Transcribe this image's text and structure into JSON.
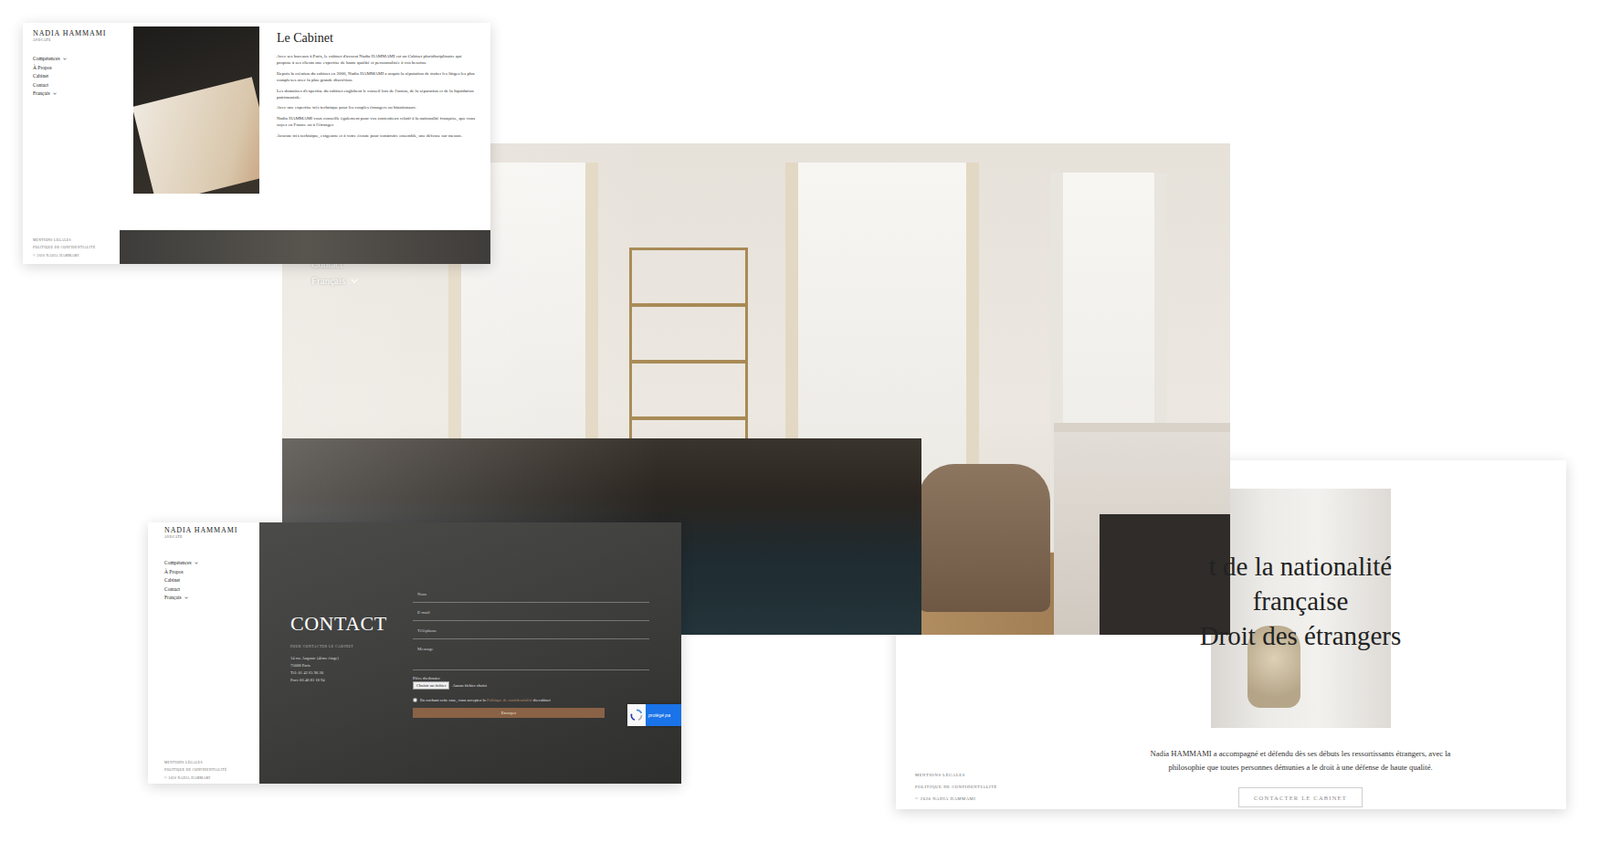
{
  "cabinet_page": {
    "logo": "NADIA HAMMAMI",
    "logo_sub": "AVOCATE",
    "nav": [
      {
        "label": "Compétences",
        "dropdown": true
      },
      {
        "label": "À Propos",
        "dropdown": false
      },
      {
        "label": "Cabinet",
        "dropdown": false
      },
      {
        "label": "Contact",
        "dropdown": false
      },
      {
        "label": "Français",
        "dropdown": true
      }
    ],
    "title": "Le Cabinet",
    "paragraphs": [
      "Avec ses bureaux à Paris, le cabinet d'avocat Nadia HAMMAMI est un Cabinet pluridisciplinaire qui propose à ses clients une expertise de haute qualité et personnalisée à vos besoins.",
      "Depuis la création du cabinet en 2000, Nadia HAMMAMI a acquis la réputation de traiter les litiges les plus complexes avec la plus grande discrétion.",
      "Les domaines d'expertise du cabinet englobent le conseil lors de l'union, de la séparation et de la liquidation patrimoniale.",
      "Avec une expertise très technique pour les couples étrangers ou binationaux.",
      "Nadia HAMMAMI vous conseille également pour vos contentieux relatif à la nationalité française, que vous soyez en France ou à l'étranger.",
      "Avocate très technique, exigeante et à votre écoute pour construire ensemble, une défense sur mesure."
    ],
    "footer": [
      "MENTIONS LÉGALES",
      "POLITIQUE DE CONFIDENTIALITÉ",
      "© 2020 NADIA HAMMAMI"
    ]
  },
  "home_page": {
    "nav": [
      {
        "label": "Contact",
        "dropdown": false
      },
      {
        "label": "Français",
        "dropdown": true
      }
    ]
  },
  "contact_page": {
    "logo": "NADIA HAMMAMI",
    "logo_sub": "AVOCATE",
    "nav": [
      {
        "label": "Compétences",
        "dropdown": true
      },
      {
        "label": "À Propos",
        "dropdown": false
      },
      {
        "label": "Cabinet",
        "dropdown": false
      },
      {
        "label": "Contact",
        "dropdown": false
      },
      {
        "label": "Français",
        "dropdown": true
      }
    ],
    "footer": [
      "MENTIONS LÉGALES",
      "POLITIQUE DE CONFIDENTIALITÉ",
      "© 2020 NADIA HAMMAMI"
    ],
    "title": "CONTACT",
    "subtitle": "POUR CONTACTER LE CABINET",
    "address": [
      "14 rue Auguste (4ème étage)",
      "75008 Paris",
      "Tél: 01 42 65 90 20",
      "Port: 06 48 83 18 94"
    ],
    "fields": [
      {
        "placeholder": "Nom"
      },
      {
        "placeholder": "E-mail"
      },
      {
        "placeholder": "Téléphone"
      },
      {
        "placeholder": "Message"
      }
    ],
    "file": {
      "label": "Pièce du dossier",
      "button": "Choisir un fichier",
      "status": "Aucun fichier choisi"
    },
    "consent": {
      "before": "En cochant cette case, vous acceptez la ",
      "link": "Politique de confidentialité",
      "after": " du cabinet",
      "checked": false
    },
    "submit": "Envoyer",
    "captcha": "protégé pa"
  },
  "nationality_page": {
    "heading": [
      "t de la nationalité",
      "française",
      "Droit des étrangers"
    ],
    "text": "Nadia HAMMAMI a accompagné et défendu dès ses débuts les ressortissants étrangers, avec la philosophie que toutes personnes démunies a le droit à une défense de haute qualité.",
    "button": "CONTACTER LE CABINET",
    "footer": [
      "MENTIONS LÉGALES",
      "POLITIQUE DE CONFIDENTIALITÉ",
      "© 2020 NADIA HAMMAMI"
    ]
  }
}
